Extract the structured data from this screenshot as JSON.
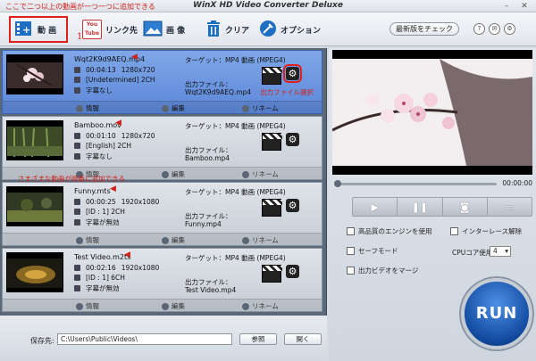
{
  "window": {
    "title": "WinX HD Video Converter Deluxe"
  },
  "annotations": {
    "top": "ここで二つ以上の動画が一つ一つに追加できる",
    "marker_one": "1",
    "output_select": "出力ファイル選択",
    "sequence_add": "さまざまな動画が順番に追加できる"
  },
  "toolbar": {
    "video_label": "動 画",
    "youtube_label": "リンク先",
    "youtube_logo": "You Tube",
    "image_label": "画 像",
    "clear_label": "クリア",
    "option_label": "オプション",
    "update_label": "最新版をチェック"
  },
  "items": [
    {
      "name": "Wqt2K9d9AEQ.mp4",
      "duration": "00:04:13",
      "resolution": "1280x720",
      "audio": "[Undetermined] 2CH",
      "subtitle": "字幕なし",
      "target": "ターゲット：MP4 動画 (MPEG4)",
      "output_label": "出力ファイル：",
      "output_name": "Wqt2K9d9AEQ.mp4",
      "info": "情報",
      "edit": "編集",
      "rename": "リネーム"
    },
    {
      "name": "Bamboo.mov",
      "duration": "00:01:10",
      "resolution": "1280x720",
      "audio": "[English] 2CH",
      "subtitle": "字幕なし",
      "target": "ターゲット：MP4 動画 (MPEG4)",
      "output_label": "出力ファイル：",
      "output_name": "Bamboo.mp4",
      "info": "情報",
      "edit": "編集",
      "rename": "リネーム"
    },
    {
      "name": "Funny.mts",
      "duration": "00:00:25",
      "resolution": "1920x1080",
      "audio": "[ID : 1] 2CH",
      "subtitle": "字幕が無効",
      "target": "ターゲット：MP4 動画 (MPEG4)",
      "output_label": "出力ファイル：",
      "output_name": "Funny.mp4",
      "info": "情報",
      "edit": "編集",
      "rename": "リネーム"
    },
    {
      "name": "Test Video.m2ts",
      "duration": "00:02:16",
      "resolution": "1920x1080",
      "audio": "[ID : 1] 6CH",
      "subtitle": "字幕が無効",
      "target": "ターゲット：MP4 動画 (MPEG4)",
      "output_label": "出力ファイル：",
      "output_name": "Test Video.mp4",
      "info": "情報",
      "edit": "編集",
      "rename": "リネーム"
    }
  ],
  "bottom": {
    "save_label": "保存先:",
    "save_path": "C:\\Users\\Public\\Videos\\",
    "browse_label": "参照",
    "open_label": "開く"
  },
  "preview": {
    "time": "00:00:00"
  },
  "options": {
    "hw_engine": "高品質のエンジンを使用",
    "deinterlace": "インターレース解除",
    "safe_mode": "セーフモード",
    "cpu_label": "CPUコア使用数:",
    "cpu_value": "4",
    "merge": "出力ビデオをマージ"
  },
  "run_label": "RUN"
}
